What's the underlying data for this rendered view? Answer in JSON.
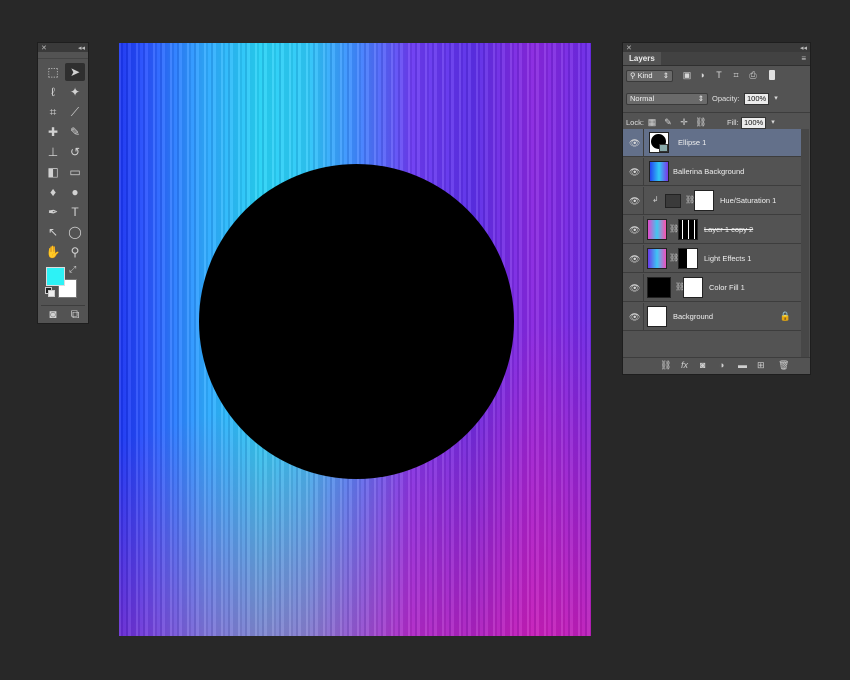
{
  "tools_panel": {
    "close_glyph": "✕",
    "collapse_glyph": "◂◂",
    "foreground_color": "#2df2f6",
    "background_color": "#ffffff",
    "tools": [
      {
        "name": "rect-marquee",
        "glyph": "⬚"
      },
      {
        "name": "path-selection",
        "glyph": "➤"
      },
      {
        "name": "lasso",
        "glyph": "ℓ"
      },
      {
        "name": "magic-wand",
        "glyph": "✦"
      },
      {
        "name": "crop",
        "glyph": "⌗"
      },
      {
        "name": "eyedropper",
        "glyph": "⟋"
      },
      {
        "name": "healing-brush",
        "glyph": "✚"
      },
      {
        "name": "brush",
        "glyph": "✎"
      },
      {
        "name": "clone-stamp",
        "glyph": "⊥"
      },
      {
        "name": "history-brush",
        "glyph": "↺"
      },
      {
        "name": "eraser",
        "glyph": "◧"
      },
      {
        "name": "gradient",
        "glyph": "▭"
      },
      {
        "name": "blur",
        "glyph": "♦"
      },
      {
        "name": "dodge",
        "glyph": "●"
      },
      {
        "name": "pen",
        "glyph": "✒"
      },
      {
        "name": "type",
        "glyph": "T"
      },
      {
        "name": "direct-selection",
        "glyph": "↖"
      },
      {
        "name": "ellipse",
        "glyph": "◯"
      },
      {
        "name": "hand",
        "glyph": "✋"
      },
      {
        "name": "zoom",
        "glyph": "⚲"
      }
    ]
  },
  "layers_panel": {
    "tab_label": "Layers",
    "close_glyph": "✕",
    "collapse_glyph": "◂◂",
    "filter_label": "Kind",
    "blend_mode": "Normal",
    "opacity_label": "Opacity:",
    "opacity_value": "100%",
    "lock_label": "Lock:",
    "fill_label": "Fill:",
    "fill_value": "100%",
    "layers": [
      {
        "name": "Ellipse 1",
        "type": "shape",
        "selected": true
      },
      {
        "name": "Ballerina Background",
        "type": "image",
        "selected": false
      },
      {
        "name": "Hue/Saturation 1",
        "type": "adjustment",
        "selected": false
      },
      {
        "name": "Layer 1 copy 2",
        "type": "image-mask",
        "selected": false
      },
      {
        "name": "Light Effects 1",
        "type": "image-mask",
        "selected": false
      },
      {
        "name": "Color Fill 1",
        "type": "fill",
        "selected": false
      },
      {
        "name": "Background",
        "type": "background",
        "selected": false
      }
    ]
  },
  "canvas": {
    "shape_color": "#000000",
    "gradient_colors": [
      "#1a34f0",
      "#28d2f5",
      "#6d3cf2",
      "#ff1496"
    ]
  }
}
